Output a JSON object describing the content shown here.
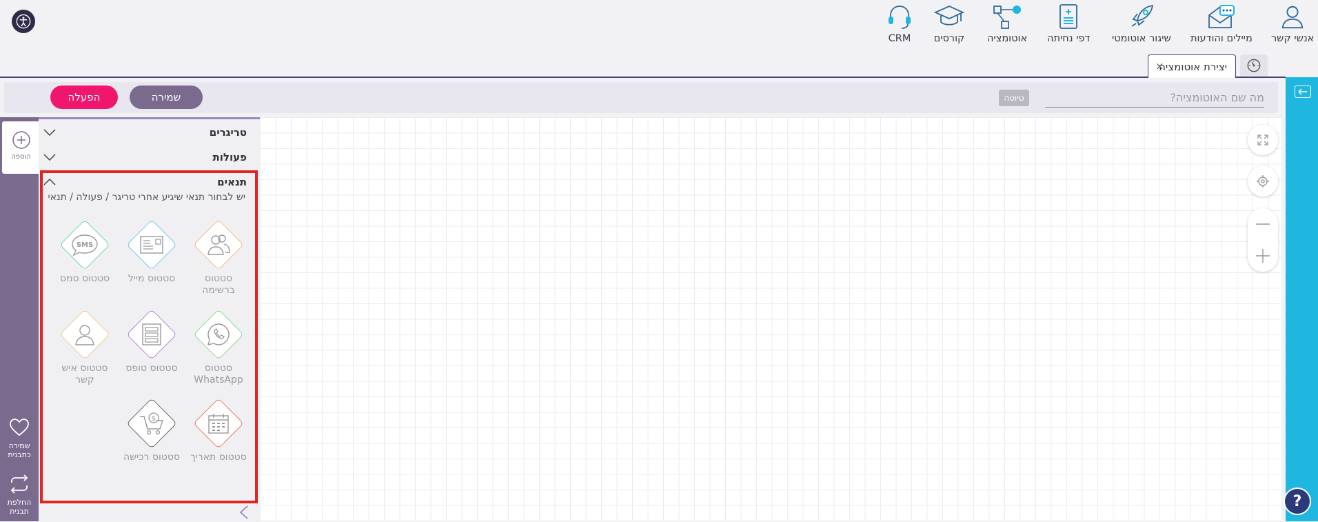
{
  "nav": {
    "items": [
      {
        "label": "אנשי קשר",
        "icon": "person-icon"
      },
      {
        "label": "מיילים והודעות",
        "icon": "mail-chat-icon"
      },
      {
        "label": "שיגור אוטומטי",
        "icon": "rocket-icon"
      },
      {
        "label": "דפי נחיתה",
        "icon": "landing-page-icon"
      },
      {
        "label": "אוטומציה",
        "icon": "automation-icon"
      },
      {
        "label": "קורסים",
        "icon": "graduation-cap-icon"
      },
      {
        "label": "CRM",
        "icon": "headset-icon"
      }
    ]
  },
  "tabs": {
    "active_label": "יצירת אוטומציה",
    "close": "×"
  },
  "header": {
    "name_placeholder": "מה שם האוטומציה?",
    "draft_badge": "טיוטה",
    "save_label": "שמירה",
    "activate_label": "הפעלה"
  },
  "left_strip": {
    "add_label": "הוספה",
    "save_template_label": "שמירה כתבנית",
    "switch_template_label": "החלפת תבנית"
  },
  "panel": {
    "triggers_title": "טריגרים",
    "actions_title": "פעולות",
    "conditions_title": "תנאים",
    "conditions_desc": "יש לבחור תנאי שיגיע אחרי טריגר / פעולה / תנאי",
    "cards": [
      {
        "label": "סטטוס ברשימה",
        "icon": "list-status-icon",
        "color": "#f5b98a"
      },
      {
        "label": "סטטוס מייל",
        "icon": "email-status-icon",
        "color": "#7ec3ea"
      },
      {
        "label": "סטטוס סמס",
        "icon": "sms-status-icon",
        "color": "#6fd6b3"
      },
      {
        "label": "סטטוס WhatsApp",
        "icon": "whatsapp-status-icon",
        "color": "#8fdc8f"
      },
      {
        "label": "סטטוס טופס",
        "icon": "form-status-icon",
        "color": "#b488d8"
      },
      {
        "label": "סטטוס איש קשר",
        "icon": "contact-status-icon",
        "color": "#f5c69a"
      },
      {
        "label": "סטטוס תאריך",
        "icon": "date-status-icon",
        "color": "#ef7a6e"
      },
      {
        "label": "סטטוס רכישה",
        "icon": "purchase-status-icon",
        "color": "#6a6a6a"
      }
    ]
  }
}
